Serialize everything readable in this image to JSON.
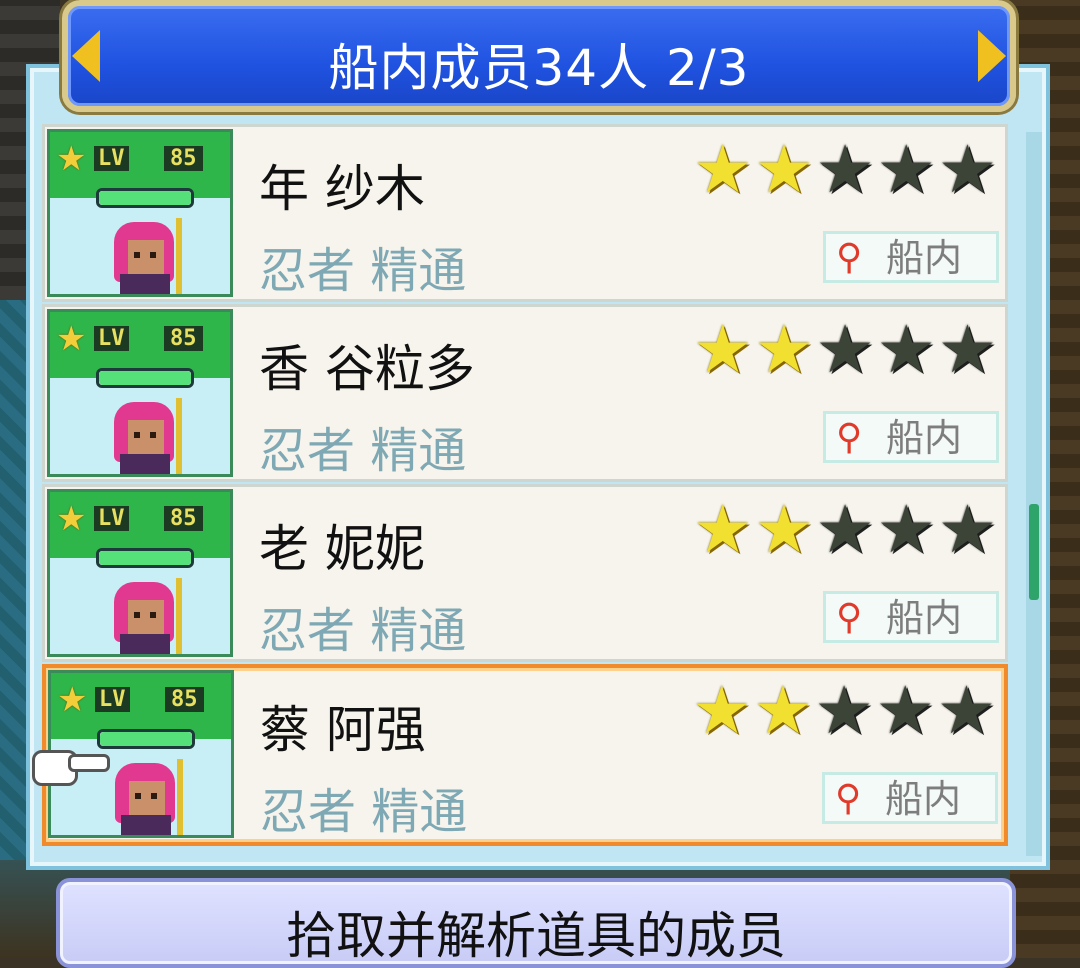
{
  "header": {
    "title": "船内成员34人    2/3"
  },
  "crew": [
    {
      "lv_label": "LV",
      "level": "85",
      "name": "年 纱木",
      "job": "忍者 精通",
      "rating": 2,
      "max_rating": 5,
      "location": "船内",
      "hp_fraction": 1.0,
      "selected": false
    },
    {
      "lv_label": "LV",
      "level": "85",
      "name": "香 谷粒多",
      "job": "忍者 精通",
      "rating": 2,
      "max_rating": 5,
      "location": "船内",
      "hp_fraction": 1.0,
      "selected": false
    },
    {
      "lv_label": "LV",
      "level": "85",
      "name": "老 妮妮",
      "job": "忍者 精通",
      "rating": 2,
      "max_rating": 5,
      "location": "船内",
      "hp_fraction": 1.0,
      "selected": false
    },
    {
      "lv_label": "LV",
      "level": "85",
      "name": "蔡 阿强",
      "job": "忍者 精通",
      "rating": 2,
      "max_rating": 5,
      "location": "船内",
      "hp_fraction": 1.0,
      "selected": true
    }
  ],
  "bottom_button": {
    "label": "拾取并解析道具的成员"
  },
  "icons": {
    "prev": "chevron-left-icon",
    "next": "chevron-right-icon",
    "location": "magnifier-icon",
    "cursor": "pointing-hand-icon",
    "rank": "star-icon"
  },
  "colors": {
    "header_blue": "#1f52e0",
    "selected_border": "#f08a2a",
    "star_on": "#f2e030",
    "star_off": "#3c4438",
    "job_text": "#7ea8b4"
  }
}
